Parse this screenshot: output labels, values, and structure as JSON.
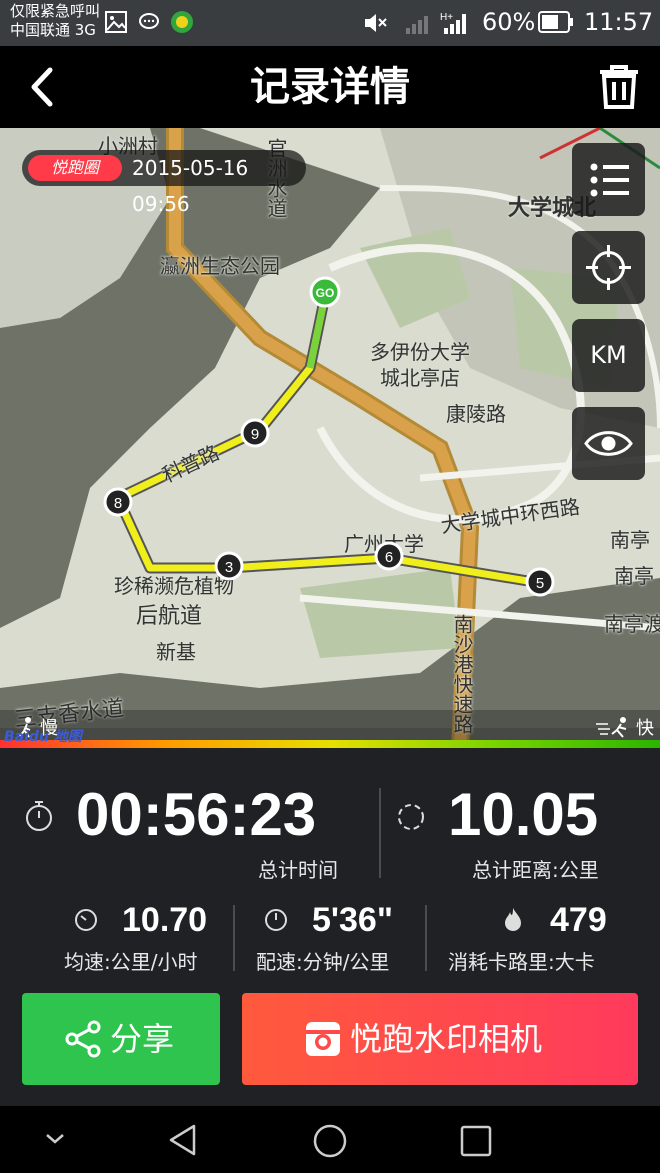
{
  "status_bar": {
    "emergency_text": "仅限紧急呼叫",
    "network_text": "中国联通 3G",
    "battery": "60%",
    "time": "11:57",
    "icons": [
      "image-icon",
      "chat-icon",
      "app-icon",
      "mute-icon",
      "signal-icon",
      "battery-icon"
    ]
  },
  "header": {
    "title": "记录详情",
    "back_icon": "back-icon",
    "delete_icon": "trash-icon"
  },
  "map": {
    "stamp_badge": "悦跑圈",
    "stamp_datetime": "2015-05-16 09:56",
    "labels": {
      "xiaozhou": "小洲村",
      "guanzhou_road": "官洲水道",
      "daxuecheng_north": "大学城北",
      "yingzhou_park": "瀛洲生态公园",
      "duoyifen": "多伊份大学",
      "chengbei": "城北亭店",
      "kangling": "康陵路",
      "keji_road": "科普路",
      "xuhuan_road": "大学城中环西路",
      "gz_university": "广州大学",
      "zhenxi": "珍稀濒危植物",
      "houhang": "后航道",
      "xinji": "新基",
      "nanting": "南亭",
      "nanting2": "南亭",
      "nanting3": "南亭渡",
      "sanzhi": "三支香水道",
      "nansha": "南沙港快速路"
    },
    "start_marker": "GO",
    "km_markers": [
      "9",
      "8",
      "3",
      "6",
      "5"
    ],
    "controls": {
      "list_icon": "list-icon",
      "locate_icon": "crosshair-icon",
      "unit_label": "KM",
      "eye_icon": "eye-icon"
    },
    "speed_legend": {
      "slow": "慢",
      "fast": "快"
    },
    "map_logo": "Baidu 地图",
    "route_color": "#f0ef1c",
    "water_color": "#6f7367",
    "land_color": "#d9dccf"
  },
  "stats": {
    "total_time": "00:56:23",
    "total_time_label": "总计时间",
    "total_distance": "10.05",
    "total_distance_label": "总计距离:公里",
    "avg_speed": "10.70",
    "avg_speed_label": "均速:公里/小时",
    "pace": "5'36\"",
    "pace_label": "配速:分钟/公里",
    "calories": "479",
    "calories_label": "消耗卡路里:大卡"
  },
  "actions": {
    "share_label": "分享",
    "camera_label": "悦跑水印相机",
    "share_color": "#2ec44d",
    "camera_color": "#ff4a4a"
  },
  "nav_bar": {
    "icons": [
      "collapse-icon",
      "back-nav-icon",
      "home-nav-icon",
      "recents-nav-icon"
    ]
  }
}
